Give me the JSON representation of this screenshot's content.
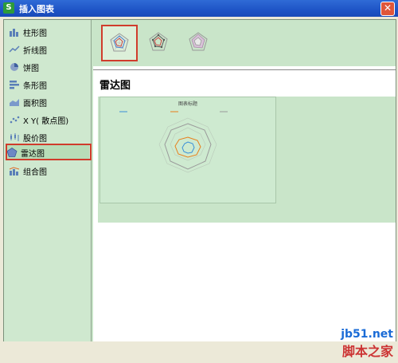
{
  "window": {
    "title": "插入图表",
    "app_icon_letter": "S"
  },
  "sidebar": {
    "items": [
      {
        "label": "柱形图",
        "icon": "column-chart-icon"
      },
      {
        "label": "折线图",
        "icon": "line-chart-icon"
      },
      {
        "label": "饼图",
        "icon": "pie-chart-icon"
      },
      {
        "label": "条形图",
        "icon": "bar-chart-icon"
      },
      {
        "label": "面积图",
        "icon": "area-chart-icon"
      },
      {
        "label": "X Y( 散点图)",
        "icon": "scatter-chart-icon"
      },
      {
        "label": "股价图",
        "icon": "stock-chart-icon"
      },
      {
        "label": "雷达图",
        "icon": "radar-chart-icon",
        "selected": true
      },
      {
        "label": "组合图",
        "icon": "combo-chart-icon"
      }
    ]
  },
  "main": {
    "section_title": "雷达图",
    "preview_title": "图表标题"
  },
  "colors": {
    "highlight": "#d03c2c",
    "panel": "#c9e5c9",
    "series1": "#3a8fd8",
    "series2": "#e87f1b",
    "series3": "#9a9a9a"
  },
  "watermark": {
    "url": "jb51.net",
    "name": "脚本之家"
  }
}
